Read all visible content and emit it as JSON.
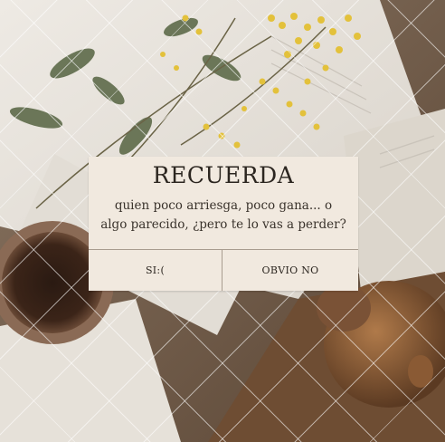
{
  "dialog": {
    "title": "RECUERDA",
    "message_line1": "quien poco arriesga, poco gana... o",
    "message_line2": "algo parecido, ¿pero te lo vas a perder?",
    "yes_label": "SI:(",
    "no_label": "OBVIO NO"
  },
  "colors": {
    "dialog_bg": "#f1e9df",
    "text": "#2c2620",
    "divider": "#a89c8f"
  }
}
